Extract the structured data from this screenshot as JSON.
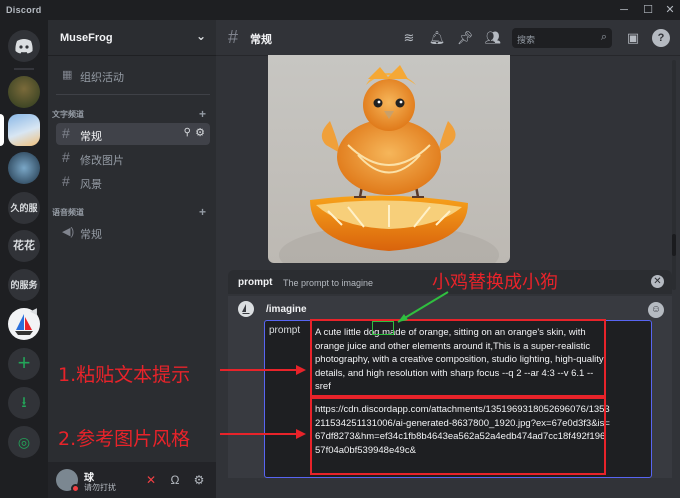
{
  "titlebar": {
    "app": "Discord",
    "minimize": "─",
    "maximize": "☐",
    "close": "✕"
  },
  "guilds": {
    "text_server_1": "久的服务",
    "text_server_2": "花花",
    "text_server_3": "的服务"
  },
  "sidebar": {
    "server_name": "MuseFrog",
    "events_label": "组织活动",
    "text_category": "文字频道",
    "channels": [
      {
        "label": "常规"
      },
      {
        "label": "修改图片"
      },
      {
        "label": "风景"
      }
    ],
    "voice_category": "语音频道",
    "voice_channels": [
      {
        "label": "常规"
      }
    ]
  },
  "user": {
    "name": "球",
    "status": "请勿打扰"
  },
  "header": {
    "channel": "常规",
    "search_placeholder": "搜索"
  },
  "autocomplete": {
    "option": "prompt",
    "description": "The prompt to imagine"
  },
  "composer": {
    "command": "/imagine",
    "param_name": "prompt",
    "prompt_before": "A cute little ",
    "prompt_highlight": "dog",
    "prompt_after": " made of orange, sitting on an orange's skin, with orange juice and other elements around it,This is a super-realistic photography, with a creative composition, studio lighting, high-quality details, and high resolution with sharp focus --q 2 --ar 4:3 --v 6.1 --sref",
    "url": "https://cdn.discordapp.com/attachments/1351969318052696076/1353211534251131006/ai-generated-8637800_1920.jpg?ex=67e0d3f3&is=67df8273&hm=ef34c1fb8b4643ea562a52a4edb474ad7cc18f492f19657f04a0bf539948e49c&"
  },
  "annotations": {
    "note_dog": "小鸡替换成小狗",
    "note_paste": "1.粘贴文本提示",
    "note_reference": "2.参考图片风格"
  },
  "colors": {
    "annotation_red": "#e8232a",
    "annotation_green": "#2fbf3f",
    "accent": "#5865f2"
  }
}
